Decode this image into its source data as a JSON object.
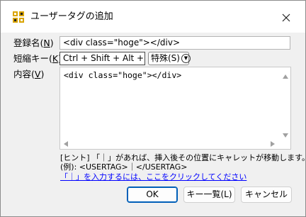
{
  "window": {
    "title": "ユーザータグの追加",
    "close_icon": "close-icon",
    "app_icon": "app-icon"
  },
  "form": {
    "name_label_prefix": "登録名(",
    "name_label_key": "N",
    "name_label_suffix": ")",
    "name_value": "<div class=\"hoge\"></div>",
    "shortcut_label_prefix": "短縮キー(",
    "shortcut_label_key": "K",
    "shortcut_label_suffix": ")",
    "shortcut_value": "Ctrl + Shift + Alt + H",
    "special_combo": "特殊(S)",
    "content_label_prefix": "内容(",
    "content_label_key": "V",
    "content_label_suffix": ")",
    "content_value": "<div class=\"hoge\"></div>"
  },
  "hint": {
    "line1": "[ヒント] 「｜」があれば、挿入後その位置にキャレットが移動します。",
    "line2": "(例): <USERTAG>｜</USERTAG>",
    "link": "「｜」を入力するには、ここをクリックしてください"
  },
  "buttons": {
    "ok": "OK",
    "key_list": "キー一覧(L)",
    "cancel": "キャンセル"
  },
  "colors": {
    "link": "#0000ff",
    "default_button_border": "#005fb8",
    "dialog_bg": "#f0f0f0"
  }
}
